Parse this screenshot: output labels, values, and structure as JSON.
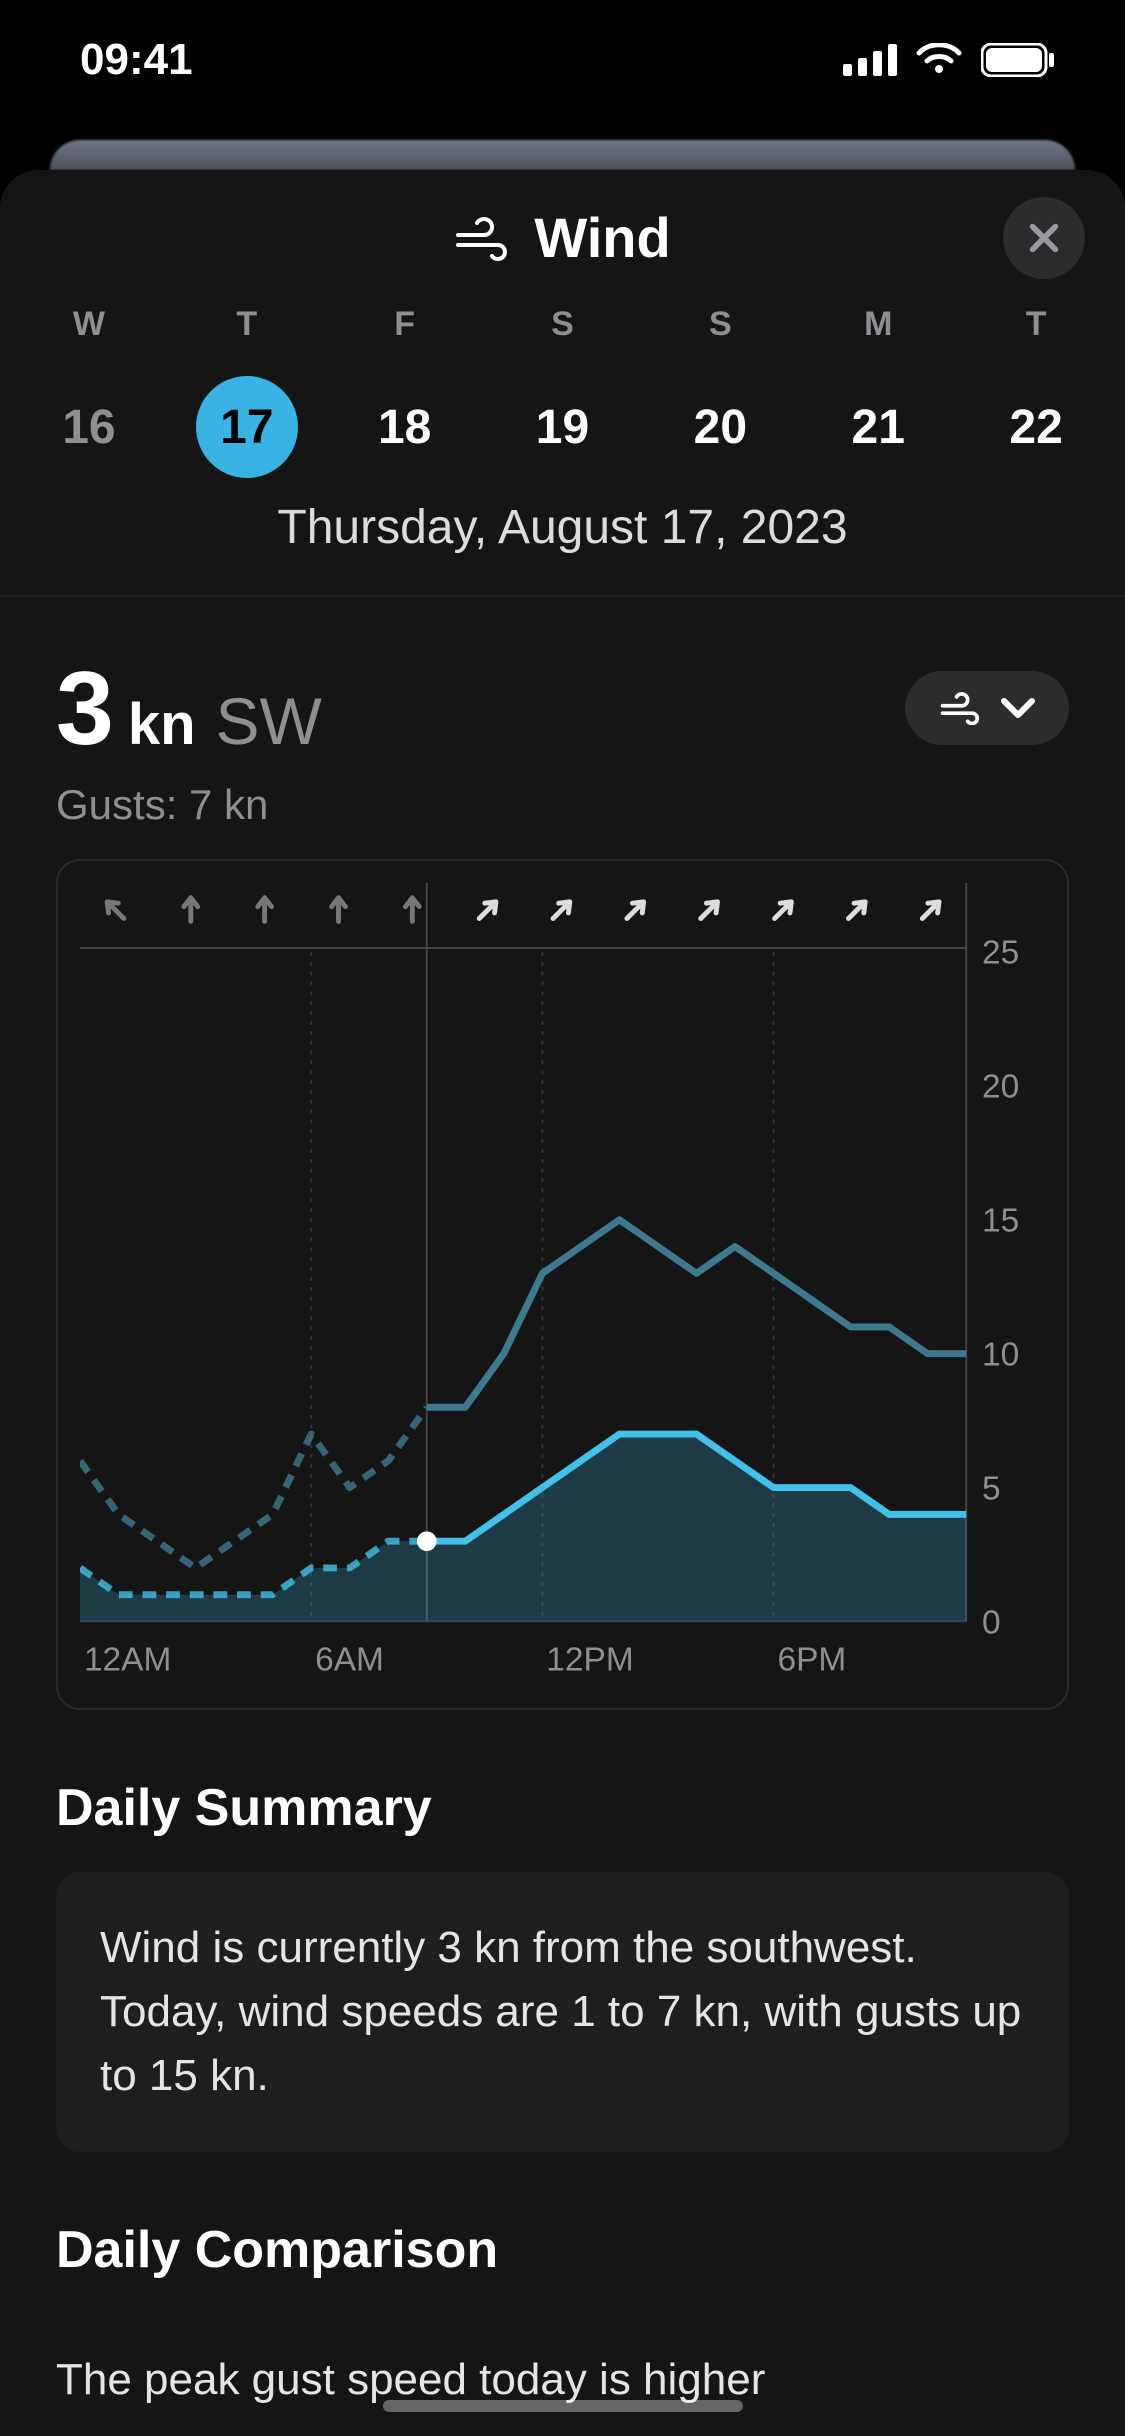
{
  "status": {
    "time": "09:41"
  },
  "header": {
    "title": "Wind"
  },
  "days": [
    {
      "letter": "W",
      "num": "16",
      "state": "dim"
    },
    {
      "letter": "T",
      "num": "17",
      "state": "selected"
    },
    {
      "letter": "F",
      "num": "18",
      "state": ""
    },
    {
      "letter": "S",
      "num": "19",
      "state": ""
    },
    {
      "letter": "S",
      "num": "20",
      "state": ""
    },
    {
      "letter": "M",
      "num": "21",
      "state": ""
    },
    {
      "letter": "T",
      "num": "22",
      "state": ""
    }
  ],
  "full_date": "Thursday, August 17, 2023",
  "reading": {
    "value": "3",
    "unit": "kn",
    "direction": "SW",
    "gusts_label": "Gusts: 7 kn"
  },
  "chart_data": {
    "type": "line",
    "x": [
      "12AM",
      "1AM",
      "2AM",
      "3AM",
      "4AM",
      "5AM",
      "6AM",
      "7AM",
      "8AM",
      "9AM",
      "10AM",
      "11AM",
      "12PM",
      "1PM",
      "2PM",
      "3PM",
      "4PM",
      "5PM",
      "6PM",
      "7PM",
      "8PM",
      "9PM",
      "10PM",
      "11PM"
    ],
    "series": [
      {
        "name": "wind",
        "values": [
          2,
          1,
          1,
          1,
          1,
          1,
          2,
          2,
          3,
          3,
          3,
          4,
          5,
          6,
          7,
          7,
          7,
          6,
          5,
          5,
          5,
          4,
          4,
          4
        ]
      },
      {
        "name": "gusts",
        "values": [
          6,
          4,
          3,
          2,
          3,
          4,
          7,
          5,
          6,
          8,
          8,
          10,
          13,
          14,
          15,
          14,
          13,
          14,
          13,
          12,
          11,
          11,
          10,
          10
        ]
      }
    ],
    "current_index": 9,
    "ylim": [
      0,
      25
    ],
    "y_ticks": [
      0,
      5,
      10,
      15,
      20,
      25
    ],
    "x_tick_labels": [
      "12AM",
      "6AM",
      "12PM",
      "6PM"
    ],
    "wind_direction_arrow_deg": [
      -45,
      0,
      0,
      0,
      0,
      45,
      45,
      45,
      45,
      45,
      45,
      45
    ],
    "arrows_past_count": 5
  },
  "summary": {
    "title": "Daily Summary",
    "text": "Wind is currently 3 kn from the southwest. Today, wind speeds are 1 to 7 kn, with gusts up to 15 kn."
  },
  "comparison": {
    "title": "Daily Comparison",
    "text": "The peak gust speed today is higher"
  },
  "colors": {
    "accent": "#38b3e3",
    "wind_line": "#41c0e9",
    "gust_line": "#3e7a8f"
  }
}
